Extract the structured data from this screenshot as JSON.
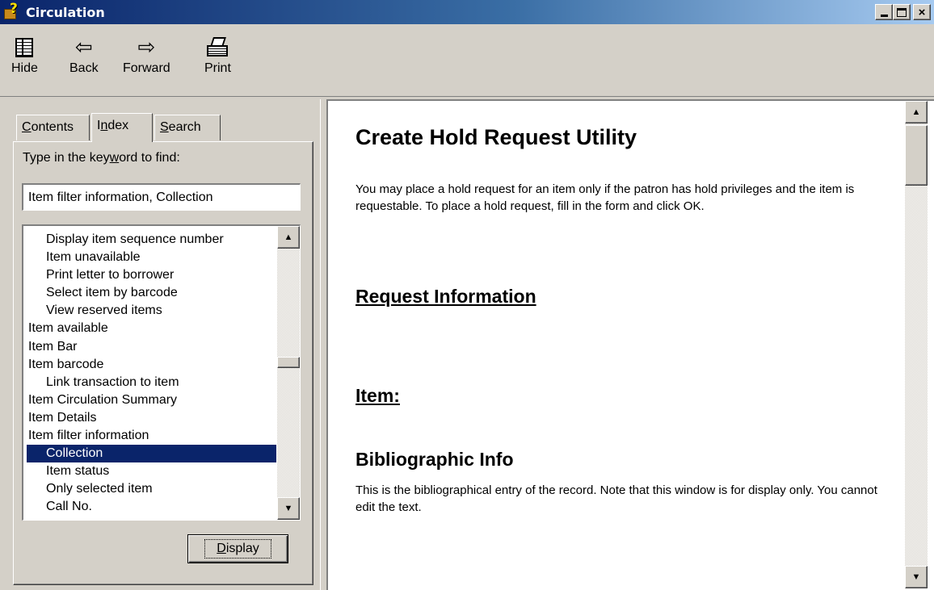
{
  "window": {
    "title": "Circulation",
    "controls": {
      "minimize": "minimize",
      "maximize": "maximize",
      "close": "×"
    }
  },
  "toolbar": {
    "hide": "Hide",
    "back": "Back",
    "forward": "Forward",
    "print": "Print"
  },
  "tabs": {
    "contents": {
      "pre": "",
      "key": "C",
      "post": "ontents"
    },
    "index": {
      "pre": "I",
      "key": "n",
      "post": "dex"
    },
    "search": {
      "pre": "",
      "key": "S",
      "post": "earch"
    }
  },
  "keyword": {
    "label_pre": "Type in the key",
    "label_key": "w",
    "label_post": "ord to find:",
    "value": "Item filter information, Collection"
  },
  "index_items": [
    {
      "text": "Display item sequence number",
      "level": 1
    },
    {
      "text": "Item unavailable",
      "level": 1
    },
    {
      "text": "Print letter to borrower",
      "level": 1
    },
    {
      "text": "Select item by barcode",
      "level": 1
    },
    {
      "text": "View reserved items",
      "level": 1
    },
    {
      "text": "Item available",
      "level": 0
    },
    {
      "text": "Item Bar",
      "level": 0
    },
    {
      "text": "Item barcode",
      "level": 0
    },
    {
      "text": "Link transaction to item",
      "level": 1
    },
    {
      "text": "Item Circulation Summary",
      "level": 0
    },
    {
      "text": "Item Details",
      "level": 0
    },
    {
      "text": "Item filter information",
      "level": 0
    },
    {
      "text": "Collection",
      "level": 1,
      "selected": true
    },
    {
      "text": "Item status",
      "level": 1
    },
    {
      "text": "Only selected item",
      "level": 1
    },
    {
      "text": "Call No.",
      "level": 1
    }
  ],
  "display_button": {
    "key": "D",
    "rest": "isplay"
  },
  "content": {
    "title": "Create Hold Request Utility",
    "intro": "You may place a hold request for an item only if the patron has hold privileges and the item is requestable. To place a hold request, fill in the form and click OK.",
    "section1": "Request Information",
    "section2": "Item:",
    "section3": "Bibliographic Info",
    "section3_text": "This is the bibliographical entry of the record. Note that this window is for display only. You cannot edit the text."
  },
  "colors": {
    "titlebar_start": "#0a246a",
    "titlebar_end": "#a6caf0",
    "selection": "#0a246a",
    "face": "#d4d0c8"
  }
}
